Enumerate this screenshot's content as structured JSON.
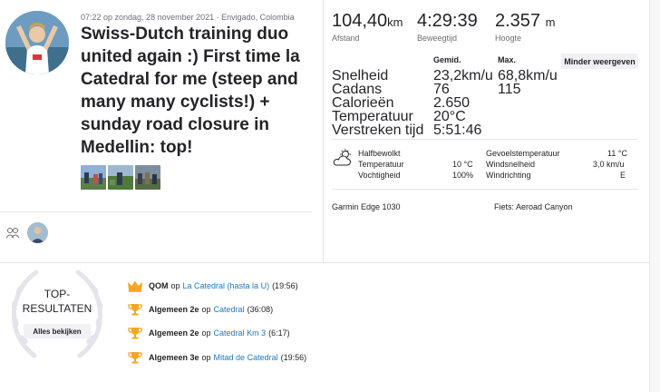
{
  "activity": {
    "meta": "07:22 op zondag, 28 november 2021 · Envigado, Colombia",
    "title": "Swiss-Dutch training duo united again :) First time la Catedral for me (steep and many many cyclists!) + sunday road closure in Medellin: top!"
  },
  "summary": {
    "distance": {
      "value": "104,40",
      "unit": "km",
      "label": "Afstand"
    },
    "moving_time": {
      "value": "4:29:39",
      "label": "Beweegtijd"
    },
    "elevation": {
      "value": "2.357",
      "unit": "m",
      "label": "Hoogte"
    }
  },
  "stats": {
    "less_button": "Minder weergeven",
    "col_avg": "Gemid.",
    "col_max": "Max.",
    "rows": [
      {
        "label": "Snelheid",
        "avg": "23,2km/u",
        "max": "68,8km/u"
      },
      {
        "label": "Cadans",
        "avg": "76",
        "max": "115"
      },
      {
        "label": "Calorieën",
        "avg": "2.650",
        "max": ""
      },
      {
        "label": "Temperatuur",
        "avg": "20°C",
        "max": ""
      },
      {
        "label": "Verstreken tijd",
        "avg": "5:51:46",
        "max": ""
      }
    ]
  },
  "weather": {
    "condition": "Halfbewolkt",
    "temp_label": "Temperatuur",
    "temp_value": "10 °C",
    "humidity_label": "Vochtigheid",
    "humidity_value": "100%",
    "feels_label": "Gevoelstemperatuur",
    "feels_value": "11 °C",
    "wind_speed_label": "Windsnelheid",
    "wind_speed_value": "3,0 km/u",
    "wind_dir_label": "Windrichting",
    "wind_dir_value": "E"
  },
  "device": {
    "device": "Garmin Edge 1030",
    "bike": "Fiets: Aeroad Canyon"
  },
  "top_results": {
    "badge_line1": "TOP-",
    "badge_line2": "RESULTATEN",
    "see_all": "Alles bekijken",
    "items": [
      {
        "icon": "crown-icon",
        "achievement": "QOM",
        "op": "op",
        "segment": "La Catedral (hasta la U)",
        "time": "(19:56)"
      },
      {
        "icon": "trophy-icon",
        "achievement": "Algemeen 2e",
        "op": "op",
        "segment": "Catedral",
        "time": "(36:08)"
      },
      {
        "icon": "trophy-icon",
        "achievement": "Algemeen 2e",
        "op": "op",
        "segment": "Catedral Km 3",
        "time": "(6:17)"
      },
      {
        "icon": "trophy-icon",
        "achievement": "Algemeen 3e",
        "op": "op",
        "segment": "Mitad de Catedral",
        "time": "(19:56)"
      }
    ]
  },
  "colors": {
    "link": "#1f7ab8",
    "trophy": "#f5a623",
    "divider": "#e6e6eb"
  }
}
